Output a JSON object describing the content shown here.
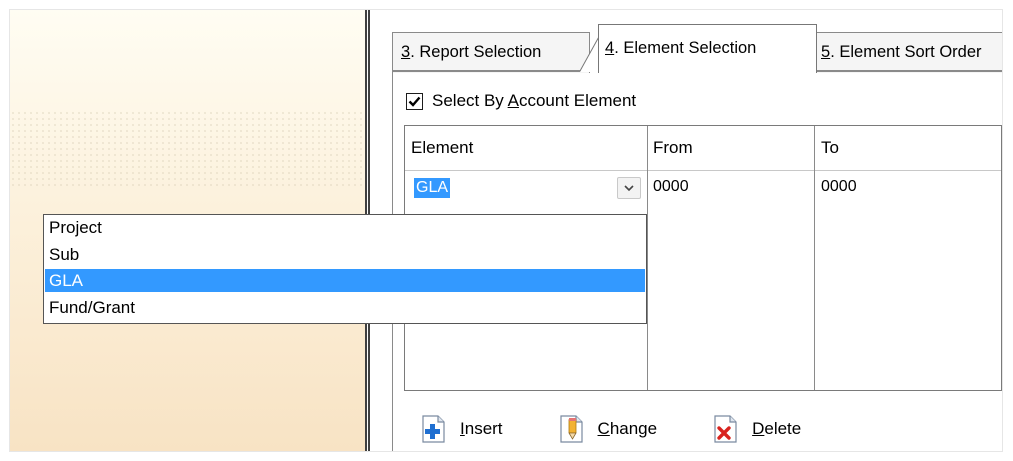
{
  "tabs": {
    "report_selection": {
      "number": "3",
      "rest": ". Report Selection"
    },
    "element_selection": {
      "number": "4",
      "rest": ". Element Selection"
    },
    "element_sort": {
      "number": "5",
      "rest": ". Element Sort Order"
    }
  },
  "checkbox": {
    "label_before": "Select By ",
    "label_mnemonic": "A",
    "label_after": "ccount Element",
    "checked": true
  },
  "grid": {
    "columns": [
      "Element",
      "From",
      "To"
    ],
    "row": {
      "element": "GLA",
      "from": "0000",
      "to": "0000"
    }
  },
  "dropdown": {
    "options": [
      "Project",
      "Sub",
      "GLA",
      "Fund/Grant"
    ],
    "selected": "GLA"
  },
  "actions": {
    "insert": {
      "mnemonic": "I",
      "rest": "nsert"
    },
    "change": {
      "mnemonic": "C",
      "rest": "hange"
    },
    "delete": {
      "mnemonic": "D",
      "rest": "elete"
    }
  },
  "colors": {
    "selection": "#3399ff",
    "left_panel_top": "#fffdf3",
    "left_panel_bottom": "#f8e3c4"
  },
  "icons": [
    "checkmark-icon",
    "chevron-down-icon",
    "insert-icon",
    "change-icon",
    "delete-icon"
  ]
}
